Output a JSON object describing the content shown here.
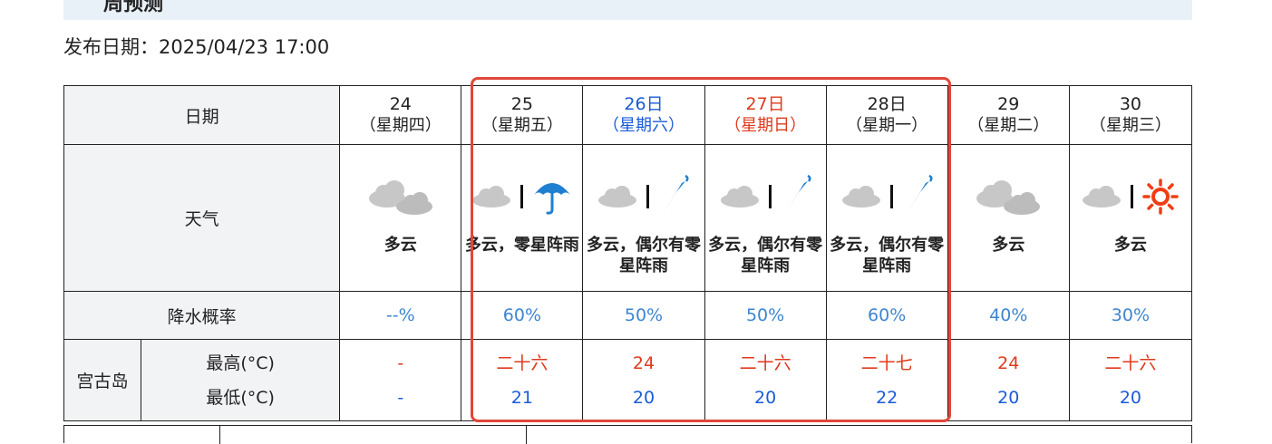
{
  "page_title": "周预测",
  "publish": {
    "label": "发布日期：2025/04/23 17:00"
  },
  "table": {
    "date_label": "日期",
    "weather_label": "天气",
    "precip_label": "降水概率",
    "region": "宫古岛",
    "max_label": "最高(°C)",
    "min_label": "最低(°C)"
  },
  "days": [
    {
      "num": "24",
      "week": "（星期四）",
      "color": "default",
      "icon": "cloudy-icon",
      "weather": "多云",
      "precip": "--%",
      "max": "-",
      "min": "-"
    },
    {
      "num": "25",
      "week": "（星期五）",
      "color": "default",
      "icon": "cloudy-then-rain-icon",
      "weather": "多云，零星阵雨",
      "precip": "60%",
      "max": "二十六",
      "min": "21"
    },
    {
      "num": "26日",
      "week": "（星期六）",
      "color": "#1a5bd8",
      "icon": "cloudy-occasional-rain-icon",
      "weather": "多云，偶尔有零星阵雨",
      "precip": "50%",
      "max": "24",
      "min": "20"
    },
    {
      "num": "27日",
      "week": "（星期日）",
      "color": "#e0391c",
      "icon": "cloudy-occasional-rain-icon",
      "weather": "多云，偶尔有零星阵雨",
      "precip": "50%",
      "max": "二十六",
      "min": "20"
    },
    {
      "num": "28日",
      "week": "（星期一）",
      "color": "default",
      "icon": "cloudy-occasional-rain-icon",
      "weather": "多云，偶尔有零星阵雨",
      "precip": "60%",
      "max": "二十七",
      "min": "22"
    },
    {
      "num": "29",
      "week": "（星期二）",
      "color": "default",
      "icon": "cloudy-icon",
      "weather": "多云",
      "precip": "40%",
      "max": "24",
      "min": "20"
    },
    {
      "num": "30",
      "week": "（星期三）",
      "color": "default",
      "icon": "cloudy-then-sunny-icon",
      "weather": "多云",
      "precip": "30%",
      "max": "二十六",
      "min": "20"
    }
  ],
  "colors": {
    "accent_blue": "#1a5bd8",
    "accent_red": "#e0391c",
    "precip_blue": "#3d86d0",
    "highlight_border": "#e0473a",
    "label_bg": "#f1f3f5",
    "header_band": "#e8f0f8"
  }
}
